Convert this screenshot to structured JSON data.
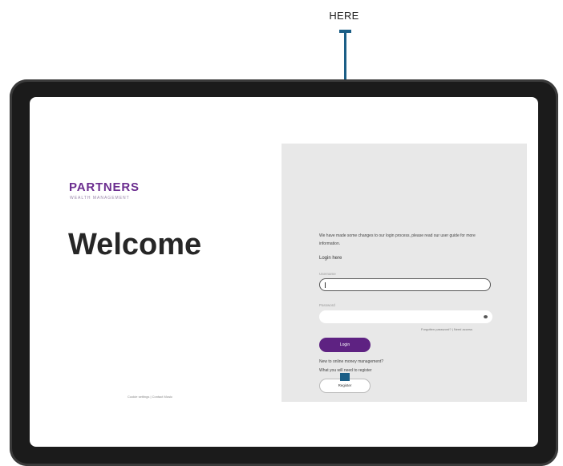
{
  "callout": {
    "label": "HERE"
  },
  "brand": {
    "name": "PARTNERS",
    "tagline": "WEALTH MANAGEMENT"
  },
  "welcome": {
    "heading": "Welcome"
  },
  "left_footer": "Cookie settings | Contact Music",
  "notice": "We have made some changes to our login process, please read our user guide for more information.",
  "login": {
    "heading": "Login here",
    "username_label": "Username",
    "password_label": "Password",
    "forgot_links": "Forgotten password?  |  Need access",
    "button": "Login"
  },
  "register": {
    "prompt_1": "New to online money management?",
    "prompt_2": "What you will need to register",
    "button": "Register"
  },
  "colors": {
    "brand_purple": "#5e2282",
    "callout_blue": "#1b5e86"
  },
  "icons": {
    "password_toggle": "eye-icon"
  }
}
